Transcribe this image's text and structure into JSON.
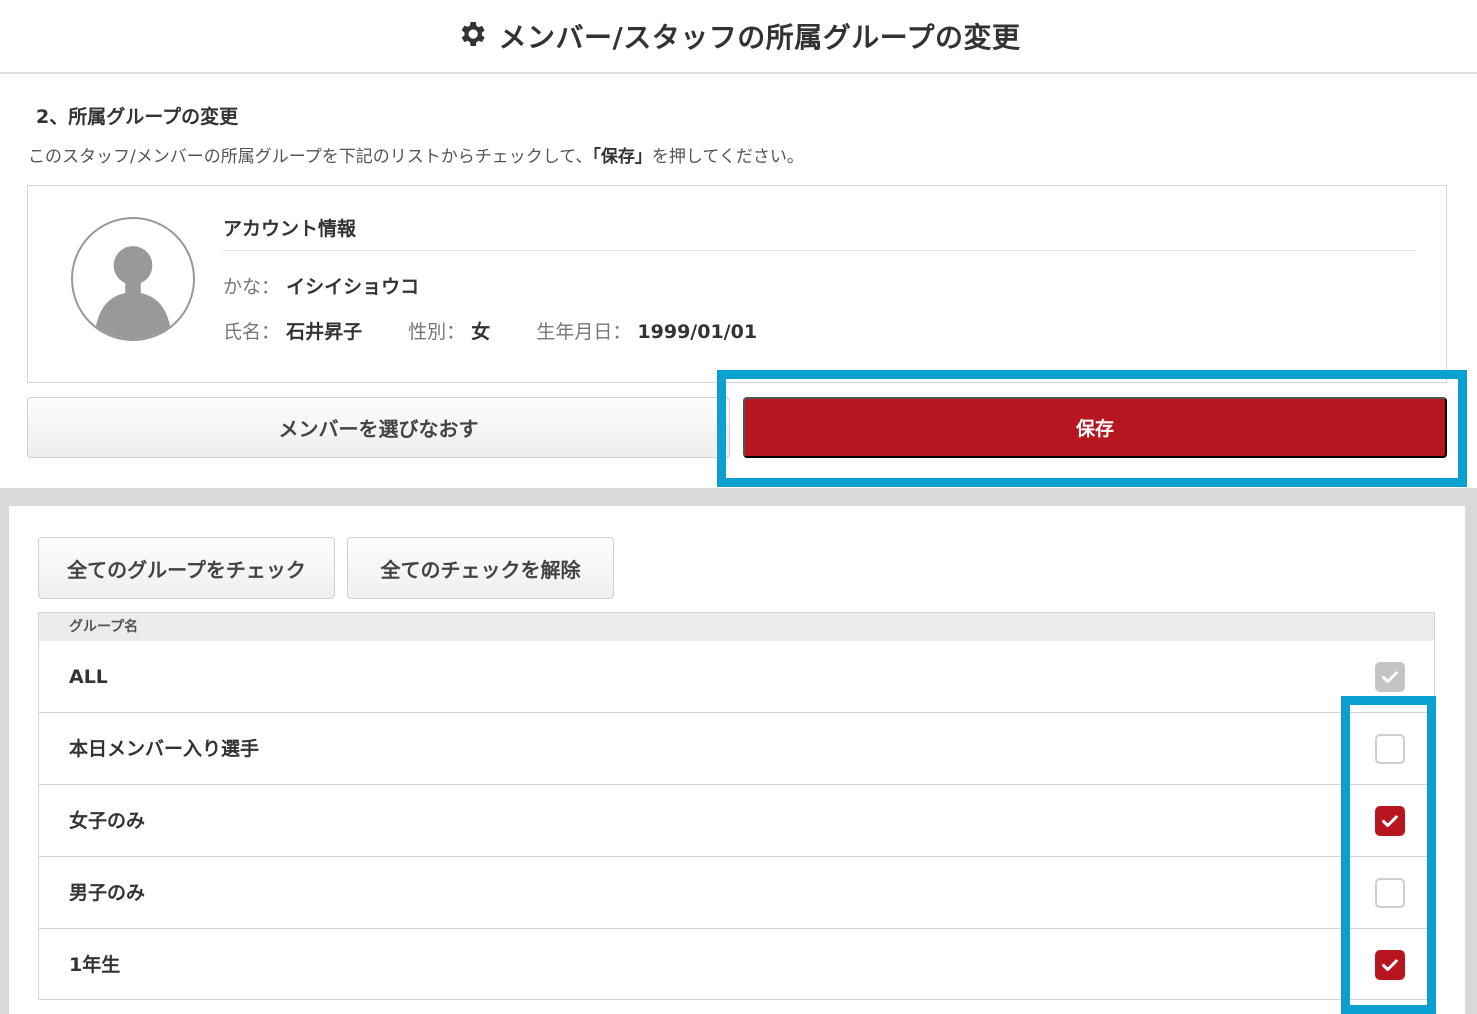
{
  "header": {
    "title": "メンバー/スタッフの所属グループの変更",
    "icon": "gear-icon"
  },
  "step": {
    "title": "2、所属グループの変更",
    "desc_before": "このスタッフ/メンバーの所属グループを下記のリストからチェックして、",
    "desc_bold": "「保存」",
    "desc_after": "を押してください。"
  },
  "account": {
    "heading": "アカウント情報",
    "kana_label": "かな：",
    "kana_value": "イシイショウコ",
    "name_label": "氏名：",
    "name_value": "石井昇子",
    "gender_label": "性別：",
    "gender_value": "女",
    "birth_label": "生年月日：",
    "birth_value": "1999/01/01"
  },
  "actions": {
    "reselect_label": "メンバーを選びなおす",
    "save_label": "保存"
  },
  "groups": {
    "check_all_label": "全てのグループをチェック",
    "uncheck_all_label": "全てのチェックを解除",
    "column_header": "グループ名",
    "rows": [
      {
        "name": "ALL",
        "state": "disabled"
      },
      {
        "name": "本日メンバー入り選手",
        "state": "unchecked"
      },
      {
        "name": "女子のみ",
        "state": "checked"
      },
      {
        "name": "男子のみ",
        "state": "unchecked"
      },
      {
        "name": "1年生",
        "state": "checked"
      }
    ]
  },
  "colors": {
    "accent_red": "#b8161f",
    "highlight_blue": "#0aa0cf"
  }
}
